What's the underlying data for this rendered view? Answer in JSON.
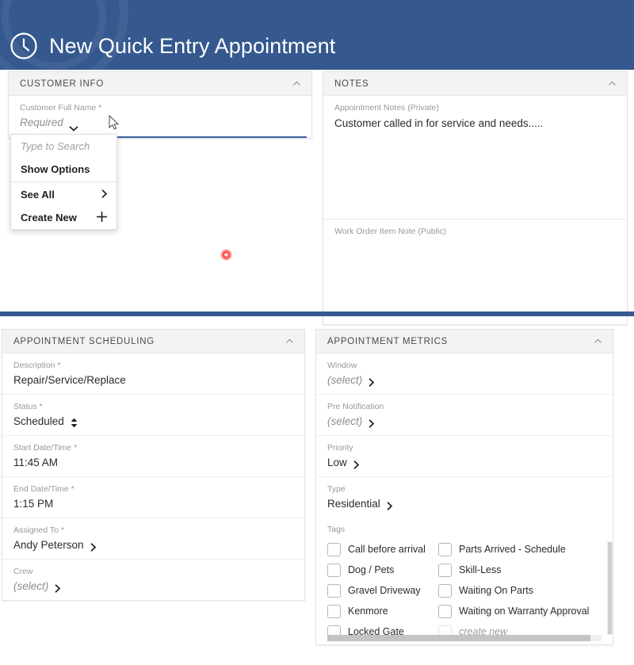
{
  "header": {
    "title": "New Quick Entry Appointment",
    "icon": "clock-icon",
    "background_color": "#35598f"
  },
  "customer_info": {
    "title": "CUSTOMER INFO",
    "collapse_icon": "chevron-up-icon",
    "field": {
      "label": "Customer Full Name *",
      "value": "Required",
      "dropdown_icon": "chevron-down-icon"
    },
    "dropdown": {
      "search_placeholder": "Type to Search",
      "items": [
        {
          "label": "Show Options",
          "icon": ""
        },
        {
          "label": "See All",
          "icon": "chevron-right-icon"
        },
        {
          "label": "Create New",
          "icon": "plus-icon"
        }
      ]
    }
  },
  "notes": {
    "title": "NOTES",
    "collapse_icon": "chevron-up-icon",
    "private": {
      "label": "Appointment Notes (Private)",
      "value": "Customer called in for service and needs....."
    },
    "public": {
      "label": "Work Order Item Note (Public)",
      "value": ""
    }
  },
  "scheduling": {
    "title": "APPOINTMENT SCHEDULING",
    "collapse_icon": "chevron-up-icon",
    "fields": [
      {
        "label": "Description *",
        "value": "Repair/Service/Replace",
        "icon": "",
        "placeholder": false
      },
      {
        "label": "Status *",
        "value": "Scheduled",
        "icon": "up-down-arrows-icon",
        "placeholder": false
      },
      {
        "label": "Start Date/Time *",
        "value": "11:45 AM",
        "icon": "",
        "placeholder": false
      },
      {
        "label": "End Date/Time *",
        "value": "1:15 PM",
        "icon": "",
        "placeholder": false
      },
      {
        "label": "Assigned To *",
        "value": "Andy Peterson",
        "icon": "chevron-right-icon",
        "placeholder": false
      },
      {
        "label": "Crew",
        "value": "(select)",
        "icon": "chevron-right-icon",
        "placeholder": true
      }
    ]
  },
  "metrics": {
    "title": "APPOINTMENT METRICS",
    "collapse_icon": "chevron-up-icon",
    "fields": [
      {
        "label": "Window",
        "value": "(select)",
        "icon": "chevron-right-icon",
        "placeholder": true
      },
      {
        "label": "Pre Notification",
        "value": "(select)",
        "icon": "chevron-right-icon",
        "placeholder": true
      },
      {
        "label": "Priority",
        "value": "Low",
        "icon": "chevron-right-icon",
        "placeholder": false
      },
      {
        "label": "Type",
        "value": "Residential",
        "icon": "chevron-right-icon",
        "placeholder": false
      }
    ],
    "tags": {
      "label": "Tags",
      "items": [
        {
          "label": "Call before arrival",
          "checked": false,
          "faint": false
        },
        {
          "label": "Parts Arrived - Schedule",
          "checked": false,
          "faint": false
        },
        {
          "label": "Dog / Pets",
          "checked": false,
          "faint": false
        },
        {
          "label": "Skill-Less",
          "checked": false,
          "faint": false
        },
        {
          "label": "Gravel Driveway",
          "checked": false,
          "faint": false
        },
        {
          "label": "Waiting On Parts",
          "checked": false,
          "faint": false
        },
        {
          "label": "Kenmore",
          "checked": false,
          "faint": false
        },
        {
          "label": "Waiting on Warranty Approval",
          "checked": false,
          "faint": false
        },
        {
          "label": "Locked Gate",
          "checked": false,
          "faint": false
        },
        {
          "label": "create new",
          "checked": false,
          "faint": true
        }
      ]
    }
  },
  "overlays": {
    "cursor": "mouse-pointer",
    "click_marker_color": "#ff3b3b"
  }
}
